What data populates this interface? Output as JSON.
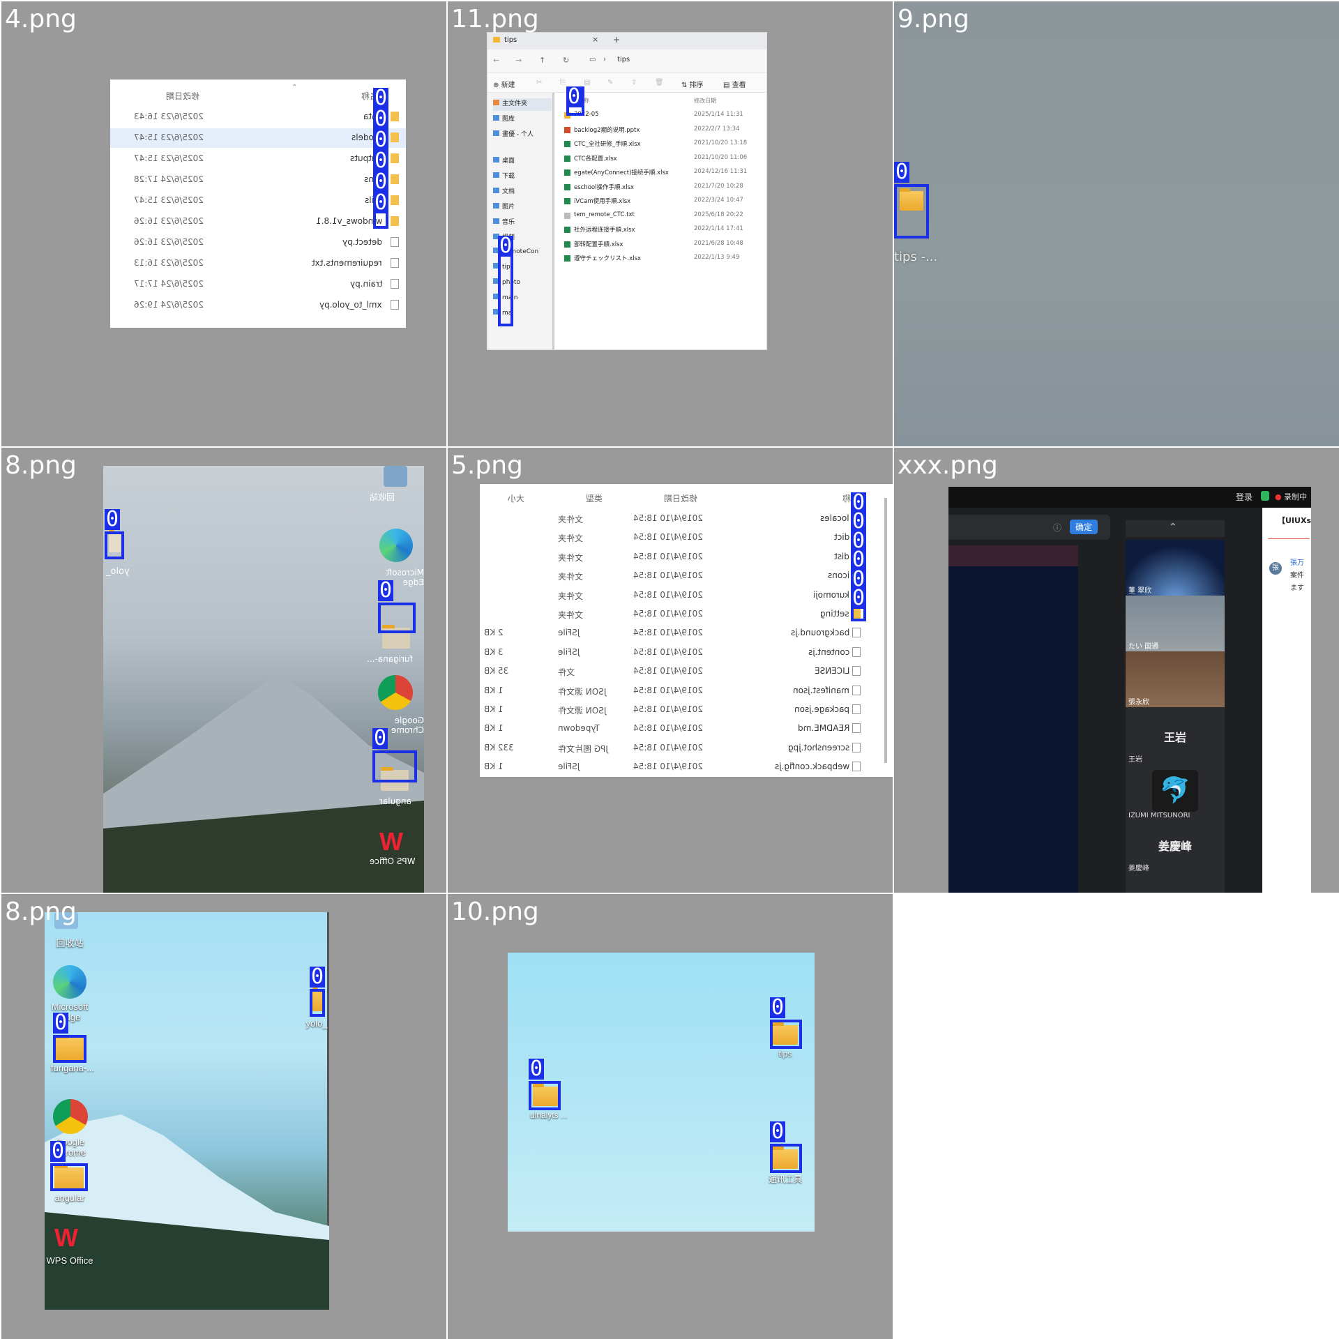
{
  "cells": [
    {
      "label": "4.png",
      "header": {
        "date": "修改日期",
        "name": "名称"
      },
      "rows": [
        {
          "name": "data",
          "date": "2025/6/23 16:43"
        },
        {
          "name": "models",
          "date": "2025/6/23 15:47"
        },
        {
          "name": "outputs",
          "date": "2025/6/23 15:47"
        },
        {
          "name": "runs",
          "date": "2025/6/24 17:28"
        },
        {
          "name": "utils",
          "date": "2025/6/23 15:47"
        },
        {
          "name": "windows_v1.8.1",
          "date": "2025/6/23 16:26"
        },
        {
          "name": "detect.py",
          "date": "2025/6/23 16:26"
        },
        {
          "name": "requirements.txt",
          "date": "2025/6/23 16:13"
        },
        {
          "name": "train.py",
          "date": "2025/6/24 17:17"
        },
        {
          "name": "xml_to_yolo.py",
          "date": "2025/6/24 19:26"
        }
      ]
    },
    {
      "label": "11.png",
      "tab": "tips",
      "path": "tips",
      "new": "新建",
      "sort": "排序",
      "view": "查看",
      "sidebar": [
        "主文件夹",
        "图库",
        "畫優 - 个人",
        "桌面",
        "下载",
        "文档",
        "图片",
        "音乐",
        "视频",
        "RemoteCon",
        "tips",
        "photo",
        "main",
        "mal"
      ],
      "col_name": "名称",
      "col_date": "修改日期",
      "files": [
        {
          "name": "2022-05",
          "date": "2025/1/14 11:31",
          "kind": "folder"
        },
        {
          "name": "backlog2期的说明.pptx",
          "date": "2022/2/7 13:34",
          "kind": "ppt"
        },
        {
          "name": "CTC_全社研修_手順.xlsx",
          "date": "2021/10/20 13:18",
          "kind": "xls"
        },
        {
          "name": "CTC各配置.xlsx",
          "date": "2021/10/20 11:06",
          "kind": "xls"
        },
        {
          "name": "egate(AnyConnect)接続手順.xlsx",
          "date": "2024/12/16 11:31",
          "kind": "xls"
        },
        {
          "name": "eschool操作手順.xlsx",
          "date": "2021/7/20 10:28",
          "kind": "xls"
        },
        {
          "name": "iVCam使用手順.xlsx",
          "date": "2022/3/24 10:47",
          "kind": "xls"
        },
        {
          "name": "tem_remote_CTC.txt",
          "date": "2025/6/18 20:22",
          "kind": "txt"
        },
        {
          "name": "社外远程连接手順.xlsx",
          "date": "2022/1/14 17:41",
          "kind": "xls"
        },
        {
          "name": "部转配置手順.xlsx",
          "date": "2021/6/28 10:48",
          "kind": "xls"
        },
        {
          "name": "遵守チェックリスト.xlsx",
          "date": "2022/1/13 9:49",
          "kind": "xls"
        }
      ]
    },
    {
      "label": "9.png",
      "folder_label": "tips -..."
    },
    {
      "label": "8.png",
      "icons": [
        "回收站",
        "Microsoft Edge",
        "furigana-...",
        "Google Chrome",
        "angular",
        "WPS Office"
      ],
      "yolo": "yolo_"
    },
    {
      "label": "5.png",
      "header": {
        "size": "大小",
        "type": "类型",
        "date": "修改日期",
        "name": "名称"
      },
      "rows": [
        {
          "name": "locales",
          "date": "2019/4/10 18:54",
          "type": "文件夹",
          "size": ""
        },
        {
          "name": "dict",
          "date": "2019/4/10 18:54",
          "type": "文件夹",
          "size": ""
        },
        {
          "name": "dist",
          "date": "2019/4/10 18:54",
          "type": "文件夹",
          "size": ""
        },
        {
          "name": "icons",
          "date": "2019/4/10 18:54",
          "type": "文件夹",
          "size": ""
        },
        {
          "name": "kuromoji",
          "date": "2019/4/10 18:54",
          "type": "文件夹",
          "size": ""
        },
        {
          "name": "setting",
          "date": "2019/4/10 18:54",
          "type": "文件夹",
          "size": ""
        },
        {
          "name": "background.js",
          "date": "2019/4/10 18:54",
          "type": "JSFile",
          "size": "2 KB"
        },
        {
          "name": "content.js",
          "date": "2019/4/10 18:54",
          "type": "JSFile",
          "size": "3 KB"
        },
        {
          "name": "LICENSE",
          "date": "2019/4/10 18:54",
          "type": "文件",
          "size": "35 KB"
        },
        {
          "name": "manifest.json",
          "date": "2019/4/10 18:54",
          "type": "JSON 源文件",
          "size": "1 KB"
        },
        {
          "name": "package.json",
          "date": "2019/4/10 18:54",
          "type": "JSON 源文件",
          "size": "1 KB"
        },
        {
          "name": "README.md",
          "date": "2019/4/10 18:54",
          "type": "Typedown",
          "size": "1 KB"
        },
        {
          "name": "screenshot.jpg",
          "date": "2019/4/10 18:54",
          "type": "JPG 图片文件",
          "size": "332 KB"
        },
        {
          "name": "webpack.config.js",
          "date": "2019/4/10 18:54",
          "type": "JSFile",
          "size": "1 KB"
        }
      ]
    },
    {
      "label": "xxx.png",
      "login": "登录",
      "record": "录制中",
      "confirm": "确定",
      "uiux": "【UIUXs",
      "participants": [
        "董 翠欣",
        "たい 国通",
        "張永欣",
        "王岩",
        "IZUMI MITSUNORI",
        "姜慶峰"
      ],
      "big_names": [
        "王岩",
        "姜慶峰"
      ],
      "side": [
        "張万",
        "案件",
        "ます"
      ]
    },
    {
      "label": "8.png",
      "icons": [
        "回收站",
        "Microsoft Edge",
        "furigana-...",
        "Google Chrome",
        "angular",
        "WPS Office"
      ],
      "yolo": "yolo_"
    },
    {
      "label": "10.png",
      "folders": [
        "tips",
        "ulnalyts ...",
        "通讯工具"
      ]
    }
  ],
  "box_label": "0",
  "colors": {
    "box": "#1a2fe6",
    "cell_bg": "#9a9a9a"
  }
}
